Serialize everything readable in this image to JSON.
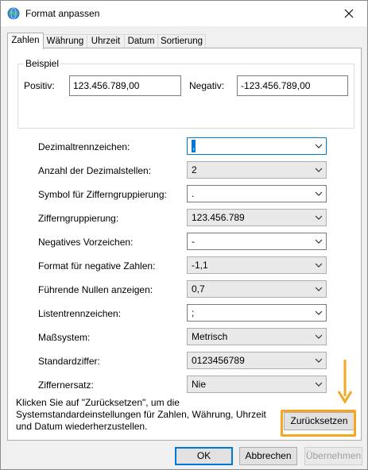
{
  "window": {
    "title": "Format anpassen",
    "close_glyph": "✕"
  },
  "tabs": [
    {
      "label": "Zahlen",
      "active": true
    },
    {
      "label": "Währung",
      "active": false
    },
    {
      "label": "Uhrzeit",
      "active": false
    },
    {
      "label": "Datum",
      "active": false
    },
    {
      "label": "Sortierung",
      "active": false
    }
  ],
  "example": {
    "group_label": "Beispiel",
    "positive_label": "Positiv:",
    "positive_value": "123.456.789,00",
    "negative_label": "Negativ:",
    "negative_value": "-123.456.789,00"
  },
  "settings": [
    {
      "label": "Dezimaltrennzeichen:",
      "value": ",",
      "editable": true,
      "focused": true
    },
    {
      "label": "Anzahl der Dezimalstellen:",
      "value": "2",
      "editable": false
    },
    {
      "label": "Symbol für Zifferngruppierung:",
      "value": ".",
      "editable": true
    },
    {
      "label": "Zifferngruppierung:",
      "value": "123.456.789",
      "editable": false
    },
    {
      "label": "Negatives Vorzeichen:",
      "value": "-",
      "editable": true
    },
    {
      "label": "Format für negative Zahlen:",
      "value": "-1,1",
      "editable": false
    },
    {
      "label": "Führende Nullen anzeigen:",
      "value": "0,7",
      "editable": false
    },
    {
      "label": "Listentrennzeichen:",
      "value": ";",
      "editable": true
    },
    {
      "label": "Maßsystem:",
      "value": "Metrisch",
      "editable": false
    },
    {
      "label": "Standardziffer:",
      "value": "0123456789",
      "editable": false
    },
    {
      "label": "Ziffernersatz:",
      "value": "Nie",
      "editable": false
    }
  ],
  "reset": {
    "note_line1": "Klicken Sie auf \"Zurücksetzen\", um die",
    "note_line2": "Systemstandardeinstellungen für Zahlen, Währung, Uhrzeit",
    "note_line3": "und Datum wiederherzustellen.",
    "button_label": "Zurücksetzen"
  },
  "footer": {
    "ok_label": "OK",
    "cancel_label": "Abbrechen",
    "apply_label": "Übernehmen"
  },
  "colors": {
    "accent": "#0078d7",
    "highlight": "#f5a623"
  }
}
